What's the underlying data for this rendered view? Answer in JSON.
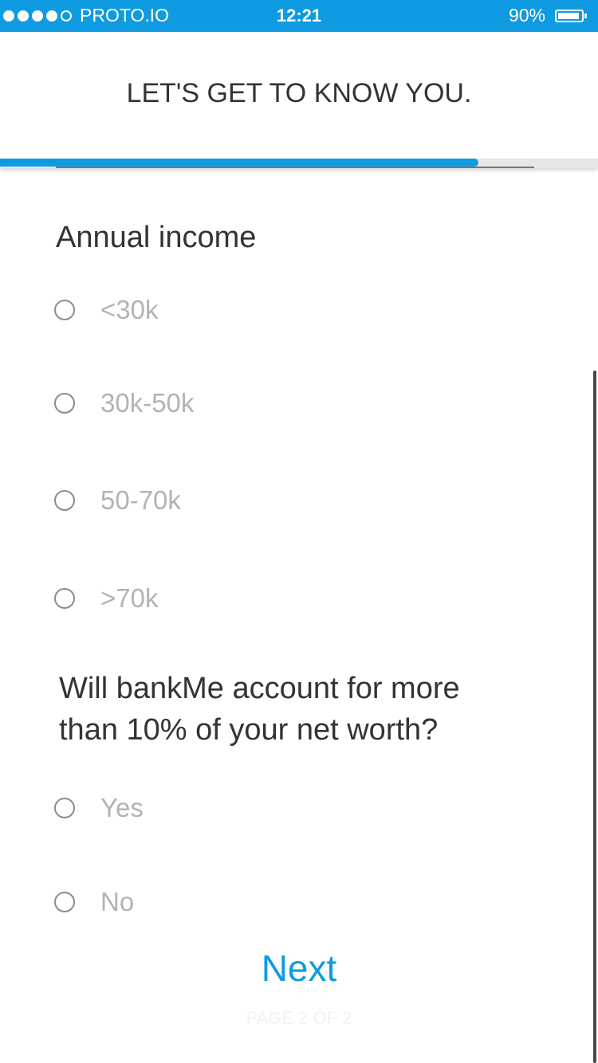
{
  "status_bar": {
    "carrier": "PROTO.IO",
    "time": "12:21",
    "battery": "90%",
    "signal_bars_filled": 4,
    "signal_bars_total": 5
  },
  "header": {
    "title": "LET'S GET TO KNOW YOU."
  },
  "progress": {
    "fraction": 0.8
  },
  "questions": [
    {
      "text": "Annual income",
      "options": [
        "<30k",
        "30k-50k",
        "50-70k",
        ">70k"
      ]
    },
    {
      "text": "Will bankMe account for more than 10% of your net worth?",
      "options": [
        "Yes",
        "No"
      ]
    }
  ],
  "footer": {
    "next_label": "Next",
    "page_indicator": "PAGE 2 OF 2"
  },
  "colors": {
    "accent": "#0f9be1",
    "option_text": "#b3b3b3",
    "question_text": "#333333"
  }
}
